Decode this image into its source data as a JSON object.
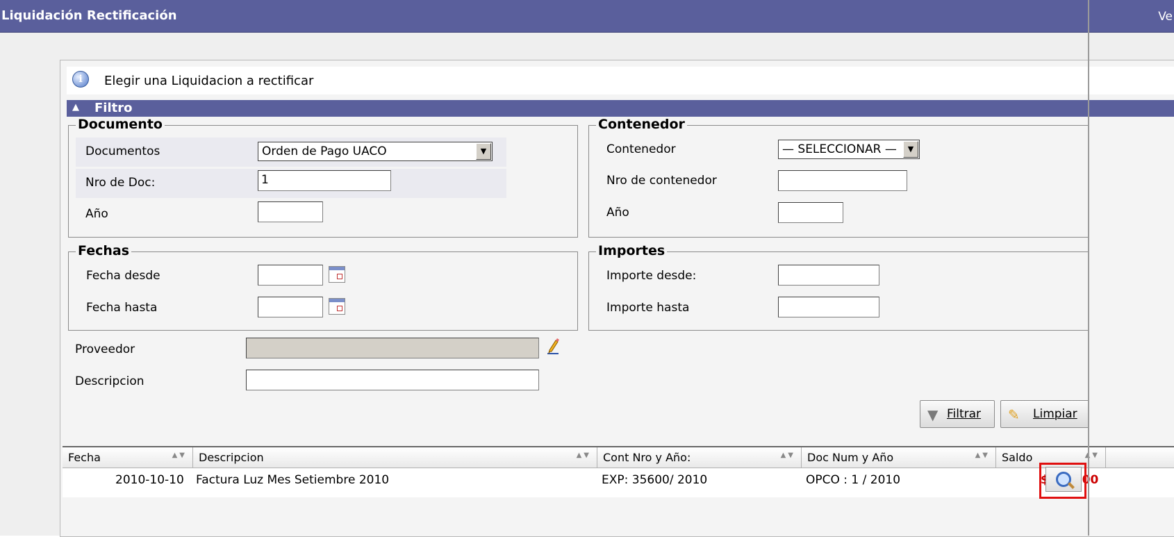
{
  "window": {
    "title": "Liquidación Rectificación",
    "corner_text": "Ve"
  },
  "info": {
    "message": "Elegir una Liquidacion a rectificar",
    "icon": "info-icon"
  },
  "filter": {
    "title": "Filtro"
  },
  "documento": {
    "legend": "Documento",
    "documentos_label": "Documentos",
    "documentos_value": "Orden de Pago UACO",
    "nro_label": "Nro de Doc:",
    "nro_value": "1",
    "anio_label": "Año",
    "anio_value": ""
  },
  "contenedor": {
    "legend": "Contenedor",
    "contenedor_label": "Contenedor",
    "contenedor_value": "— SELECCIONAR —",
    "nro_label": "Nro de contenedor",
    "nro_value": "",
    "anio_label": "Año",
    "anio_value": ""
  },
  "fechas": {
    "legend": "Fechas",
    "desde_label": "Fecha desde",
    "hasta_label": "Fecha hasta"
  },
  "importes": {
    "legend": "Importes",
    "desde_label": "Importe desde:",
    "hasta_label": "Importe hasta"
  },
  "proveedor": {
    "label": "Proveedor",
    "value": ""
  },
  "descripcion": {
    "label": "Descripcion",
    "value": ""
  },
  "buttons": {
    "filtrar": "Filtrar",
    "limpiar": "Limpiar"
  },
  "grid": {
    "columns": [
      "Fecha",
      "Descripcion",
      "Cont Nro y Año:",
      "Doc Num y Año",
      "Saldo"
    ],
    "rows": [
      {
        "fecha": "2010-10-10",
        "descripcion": "Factura Luz Mes Setiembre 2010",
        "cont": "EXP: 35600/ 2010",
        "doc": "OPCO : 1 / 2010",
        "saldo": "$ 320,00"
      }
    ]
  },
  "colors": {
    "header": "#5a5f9c",
    "saldo": "#cc0000",
    "highlight": "#e01010"
  }
}
